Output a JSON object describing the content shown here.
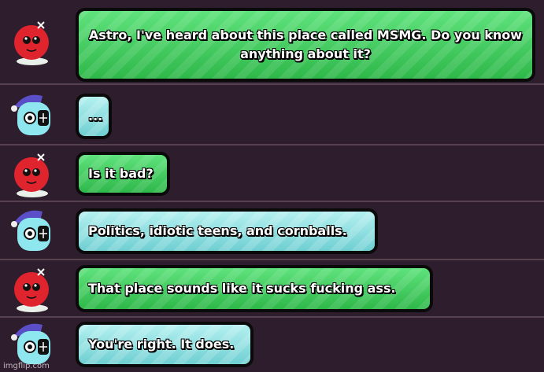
{
  "messages": [
    {
      "speaker": "red",
      "text": "Astro, I've heard about this place called MSMG. Do you know anything about it?"
    },
    {
      "speaker": "blue",
      "text": "..."
    },
    {
      "speaker": "red",
      "text": "Is it bad?"
    },
    {
      "speaker": "blue",
      "text": "Politics, idiotic teens, and cornballs."
    },
    {
      "speaker": "red",
      "text": "That place sounds like it sucks fucking ass."
    },
    {
      "speaker": "blue",
      "text": "You're right. It does."
    }
  ],
  "colors": {
    "background": "#2e1d2c",
    "divider": "#57414f",
    "red_bubble": "#3ccb5a",
    "blue_bubble": "#8fdfe0"
  },
  "icons": [
    "red-character-avatar-icon",
    "blue-character-avatar-icon"
  ],
  "watermark": "imgflip.com"
}
